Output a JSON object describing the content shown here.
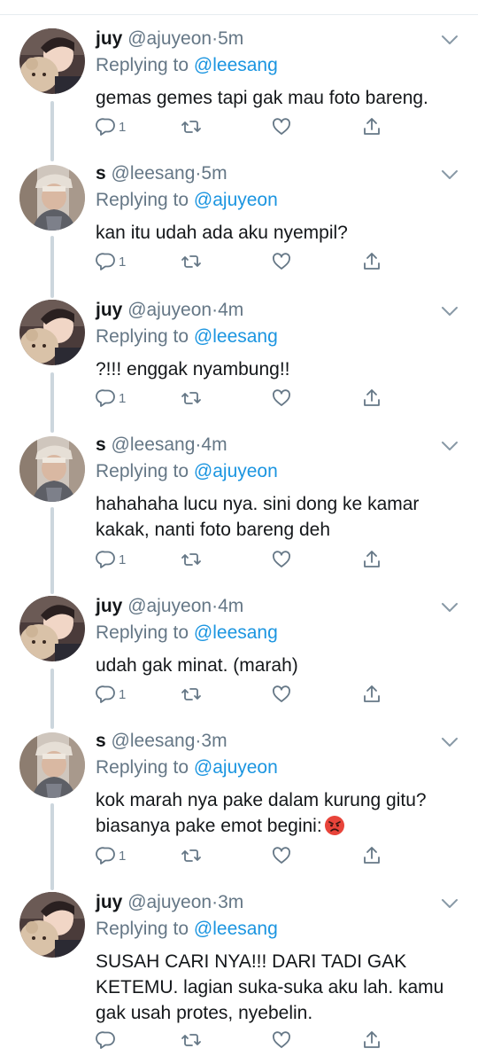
{
  "tweets": [
    {
      "name": "juy",
      "handle": "@ajuyeon",
      "separator": "·",
      "time": "5m",
      "replying_prefix": "Replying to",
      "replying_to": "@leesang",
      "text": "gemas gemes tapi gak mau foto bareng.",
      "reply_count": "1",
      "avatar_icon": "boy-with-teddy-avatar"
    },
    {
      "name": "s",
      "handle": "@leesang",
      "separator": "·",
      "time": "5m",
      "replying_prefix": "Replying to",
      "replying_to": "@ajuyeon",
      "text": "kan itu udah ada aku nyempil?",
      "reply_count": "1",
      "avatar_icon": "man-with-cap-avatar"
    },
    {
      "name": "juy",
      "handle": "@ajuyeon",
      "separator": "·",
      "time": "4m",
      "replying_prefix": "Replying to",
      "replying_to": "@leesang",
      "text": "?!!! enggak nyambung!!",
      "reply_count": "1",
      "avatar_icon": "boy-with-teddy-avatar"
    },
    {
      "name": "s",
      "handle": "@leesang",
      "separator": "·",
      "time": "4m",
      "replying_prefix": "Replying to",
      "replying_to": "@ajuyeon",
      "text": "hahahaha lucu nya. sini dong ke kamar\nkakak, nanti foto bareng deh",
      "reply_count": "1",
      "avatar_icon": "man-with-cap-avatar"
    },
    {
      "name": "juy",
      "handle": "@ajuyeon",
      "separator": "·",
      "time": "4m",
      "replying_prefix": "Replying to",
      "replying_to": "@leesang",
      "text": "udah gak minat. (marah)",
      "reply_count": "1",
      "avatar_icon": "boy-with-teddy-avatar"
    },
    {
      "name": "s",
      "handle": "@leesang",
      "separator": "·",
      "time": "3m",
      "replying_prefix": "Replying to",
      "replying_to": "@ajuyeon",
      "text": "kok marah nya pake dalam kurung gitu?\nbiasanya pake emot begini:",
      "emoji": "angry-face-emoji",
      "reply_count": "1",
      "avatar_icon": "man-with-cap-avatar"
    },
    {
      "name": "juy",
      "handle": "@ajuyeon",
      "separator": "·",
      "time": "3m",
      "replying_prefix": "Replying to",
      "replying_to": "@leesang",
      "text": "SUSAH CARI NYA!!! DARI TADI GAK\nKETEMU. lagian suka-suka aku lah. kamu\ngak usah protes, nyebelin.",
      "reply_count": "",
      "avatar_icon": "boy-with-teddy-avatar"
    }
  ],
  "colors": {
    "text": "#14171a",
    "secondary": "#657786",
    "link": "#1b95e0",
    "thread_line": "#ccd6dd",
    "angry_emoji": "#e8443a"
  }
}
